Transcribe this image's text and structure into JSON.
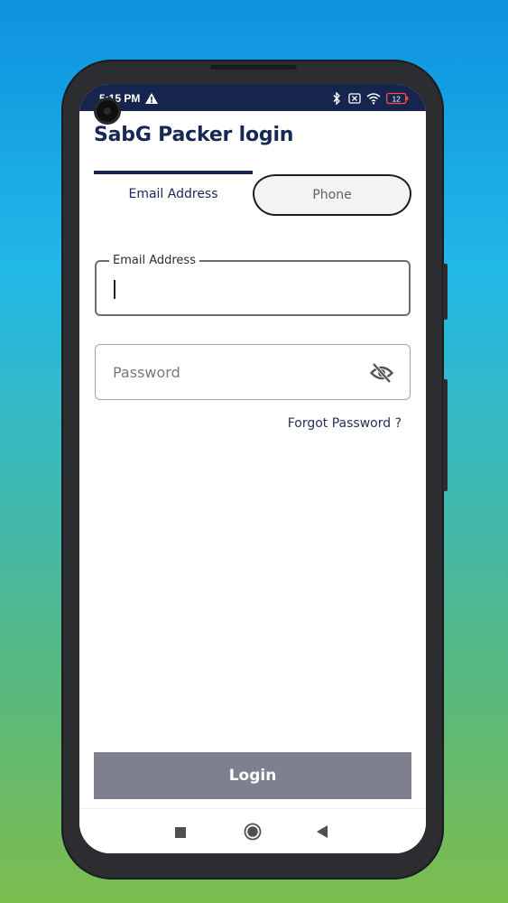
{
  "status_bar": {
    "time": "5:15 PM",
    "battery_level": "12"
  },
  "page": {
    "title": "SabG Packer login"
  },
  "tabs": [
    {
      "label": "Email Address",
      "selected": true
    },
    {
      "label": "Phone",
      "selected": false
    }
  ],
  "email_field": {
    "label": "Email Address",
    "value": ""
  },
  "password_field": {
    "placeholder": "Password",
    "value": ""
  },
  "forgot_password": "Forgot Password ?",
  "login_button": "Login",
  "colors": {
    "primary": "#16254e",
    "title": "#172853",
    "button_disabled": "#7e8090",
    "inactive_tab_bg": "#f3f3f5"
  }
}
